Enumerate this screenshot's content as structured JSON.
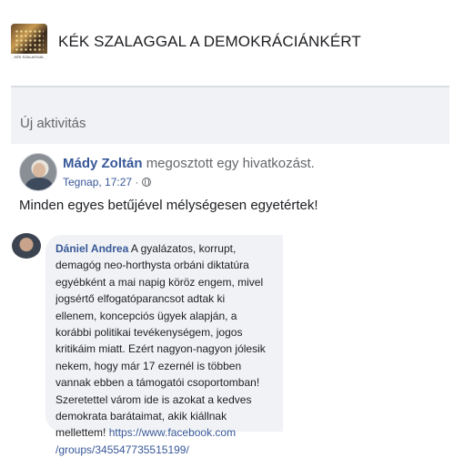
{
  "group": {
    "title": "KÉK SZALAGGAL A DEMOKRÁCIÁNKÉRT",
    "avatar_caption": "KÉK SZALAGGAL"
  },
  "activity": {
    "label": "Új aktivitás"
  },
  "post": {
    "author": "Mády Zoltán",
    "action": "megosztott egy hivatkozást.",
    "time": "Tegnap, 17:27",
    "separator": "·",
    "privacy_icon": "globe-icon",
    "text": "Minden egyes betűjével mélységesen egyetértek!"
  },
  "comment": {
    "author": "Dániel Andrea",
    "lines": [
      "A gyalázatos, korrupt,",
      "demagóg neo-horthysta orbáni diktatúra",
      "egyébként a mai napig köröz engem, mivel",
      "jogsértő elfogatóparancsot adtak ki",
      "ellenem, koncepciós ügyek alapján, a",
      "korábbi politikai tevékenységem, jogos",
      "kritikáim miatt. Ezért nagyon-nagyon jólesik",
      "nekem, hogy már 17 ezernél is többen",
      "vannak ebben a támogatói csoportomban!",
      "Szeretettel várom ide is azokat a kedves",
      "demokrata barátaimat, akik kiállnak",
      "mellettem!"
    ],
    "link_part1": "https://www.facebook.com",
    "link_part2": "/groups/345547735515199/"
  },
  "colors": {
    "link_blue": "#385898",
    "text": "#1c1e21",
    "muted": "#65676b",
    "bubble": "#f0f2f5"
  }
}
